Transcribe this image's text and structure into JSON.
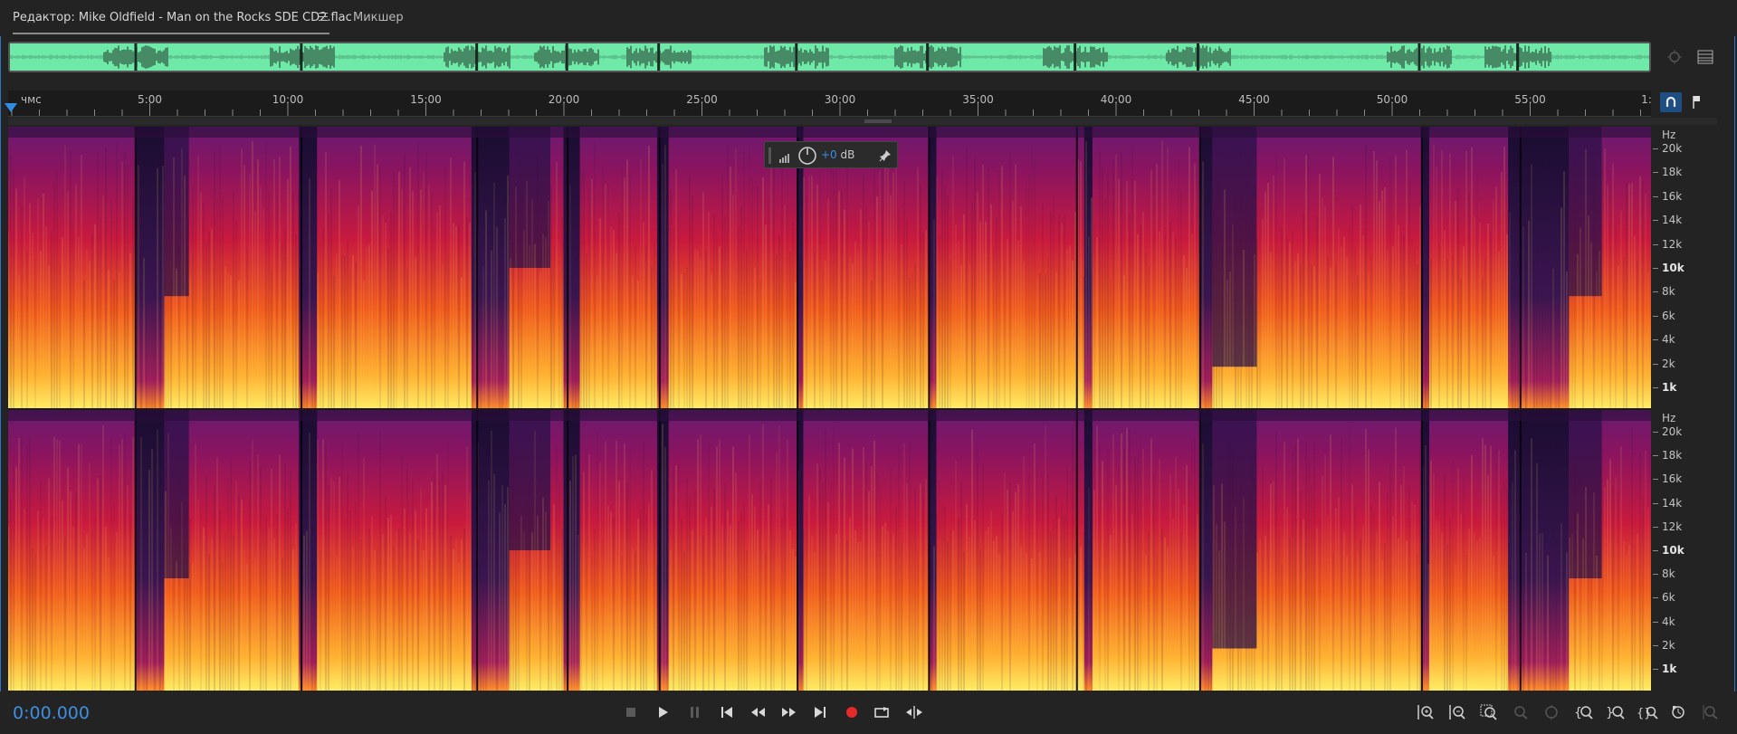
{
  "tabs": {
    "editor": "Редактор: Mike Oldfield - Man on the Rocks SDE CD2.flac",
    "mixer": "Микшер"
  },
  "ruler": {
    "unit_label": "чмс",
    "ticks": [
      "5:00",
      "10:00",
      "15:00",
      "20:00",
      "25:00",
      "30:00",
      "35:00",
      "40:00",
      "45:00",
      "50:00",
      "55:00",
      "1:"
    ]
  },
  "freq_axis": {
    "unit": "Hz",
    "labels_ch1": [
      "20k",
      "18k",
      "16k",
      "14k",
      "12k",
      "10k",
      "8k",
      "6k",
      "4k",
      "2k",
      "1k"
    ],
    "labels_ch2": [
      "20k",
      "18k",
      "16k",
      "14k",
      "12k",
      "10k",
      "8k",
      "6k",
      "4k",
      "2k",
      "1k"
    ],
    "ch1_has_12k": false
  },
  "hud": {
    "gain_value": "+0",
    "gain_unit": "dB"
  },
  "transport": {
    "timecode": "0:00.000"
  },
  "colors": {
    "accent": "#3f8fe0",
    "overview_wave": "#6ee9a8",
    "record": "#e52a2a"
  },
  "icons": {
    "transport": [
      "stop-icon",
      "play-icon",
      "pause-icon",
      "go-to-start-icon",
      "rewind-icon",
      "fast-forward-icon",
      "go-to-end-icon",
      "record-icon",
      "loop-icon",
      "skip-selection-icon"
    ],
    "zoom": [
      "zoom-in-amplitude-icon",
      "zoom-out-amplitude-icon",
      "zoom-reset-icon",
      "zoom-selection-icon",
      "zoom-in-frequency-icon",
      "zoom-out-left-icon",
      "zoom-out-right-icon",
      "zoom-out-full-icon",
      "zoom-in-time-icon",
      "zoom-out-time-icon"
    ]
  }
}
